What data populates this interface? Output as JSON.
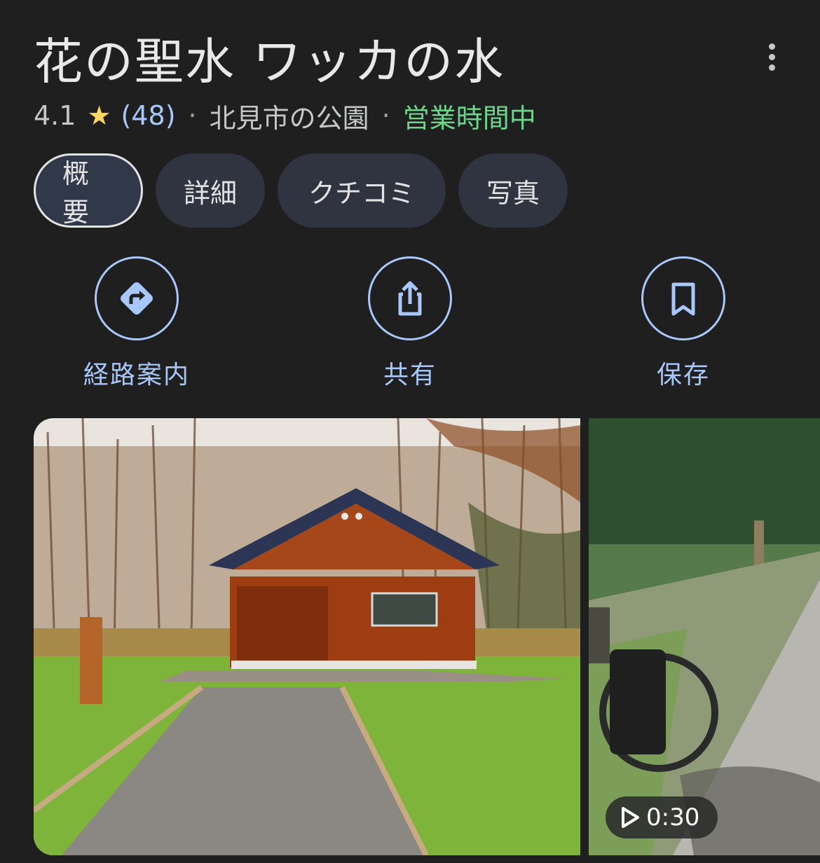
{
  "place": {
    "title": "花の聖水 ワッカの水",
    "rating": "4.1",
    "review_count": "(48)",
    "category": "北見市の公園",
    "status": "営業時間中",
    "separator": "·"
  },
  "tabs": [
    {
      "label": "概要",
      "active": true
    },
    {
      "label": "詳細",
      "active": false
    },
    {
      "label": "クチコミ",
      "active": false
    },
    {
      "label": "写真",
      "active": false
    }
  ],
  "actions": {
    "directions": {
      "label": "経路案内",
      "icon": "directions-icon"
    },
    "share": {
      "label": "共有",
      "icon": "share-icon"
    },
    "save": {
      "label": "保存",
      "icon": "bookmark-icon"
    }
  },
  "photos": {
    "video_duration": "0:30"
  },
  "colors": {
    "background": "#1f1f1f",
    "accent": "#a8c7fa",
    "star": "#fdd663",
    "open_status": "#6dd58c",
    "tab_bg": "#2f3440"
  }
}
